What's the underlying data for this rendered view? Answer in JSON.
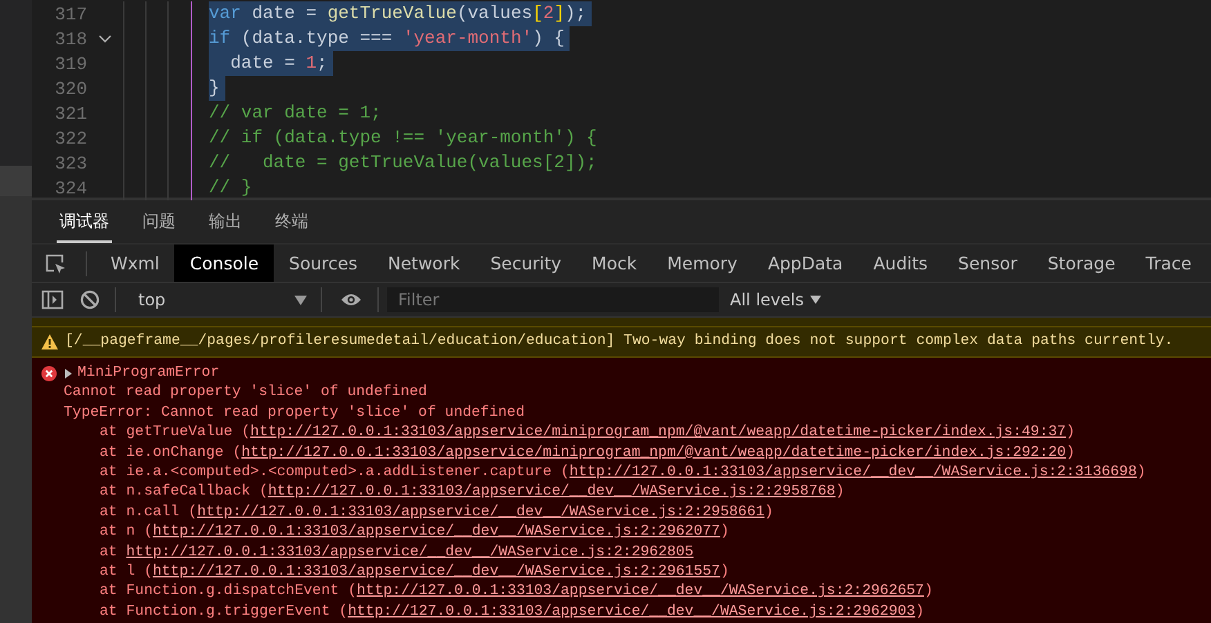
{
  "editor": {
    "lines": [
      {
        "number": "317",
        "foldable": false,
        "selected": true,
        "tokens": [
          {
            "kind": "keyword",
            "text": "var"
          },
          {
            "kind": "plain",
            "text": " date = "
          },
          {
            "kind": "func",
            "text": "getTrueValue"
          },
          {
            "kind": "plain",
            "text": "(values"
          },
          {
            "kind": "bracket",
            "text": "["
          },
          {
            "kind": "number",
            "text": "2"
          },
          {
            "kind": "bracket",
            "text": "]"
          },
          {
            "kind": "plain",
            "text": ");"
          }
        ]
      },
      {
        "number": "318",
        "foldable": true,
        "selected": true,
        "tokens": [
          {
            "kind": "keyword",
            "text": "if"
          },
          {
            "kind": "plain",
            "text": " (data.type === "
          },
          {
            "kind": "string",
            "text": "'year-month'"
          },
          {
            "kind": "plain",
            "text": ") {"
          }
        ]
      },
      {
        "number": "319",
        "foldable": false,
        "selected": true,
        "tokens": [
          {
            "kind": "plain",
            "text": "  date = "
          },
          {
            "kind": "number",
            "text": "1"
          },
          {
            "kind": "plain",
            "text": ";"
          }
        ]
      },
      {
        "number": "320",
        "foldable": false,
        "selected": true,
        "tokens": [
          {
            "kind": "plain",
            "text": "}"
          }
        ]
      },
      {
        "number": "321",
        "foldable": false,
        "selected": false,
        "tokens": [
          {
            "kind": "comment",
            "text": "// var date = 1;"
          }
        ]
      },
      {
        "number": "322",
        "foldable": false,
        "selected": false,
        "tokens": [
          {
            "kind": "comment",
            "text": "// if (data.type !== 'year-month') {"
          }
        ]
      },
      {
        "number": "323",
        "foldable": false,
        "selected": false,
        "tokens": [
          {
            "kind": "comment",
            "text": "//   date = getTrueValue(values[2]);"
          }
        ]
      },
      {
        "number": "324",
        "foldable": false,
        "selected": false,
        "tokens": [
          {
            "kind": "comment",
            "text": "// }"
          }
        ]
      }
    ]
  },
  "panel_tabs": [
    {
      "label": "调试器",
      "selected": true
    },
    {
      "label": "问题",
      "selected": false
    },
    {
      "label": "输出",
      "selected": false
    },
    {
      "label": "终端",
      "selected": false
    }
  ],
  "devtools_tabs": [
    {
      "label": "Wxml",
      "selected": false
    },
    {
      "label": "Console",
      "selected": true
    },
    {
      "label": "Sources",
      "selected": false
    },
    {
      "label": "Network",
      "selected": false
    },
    {
      "label": "Security",
      "selected": false
    },
    {
      "label": "Mock",
      "selected": false
    },
    {
      "label": "Memory",
      "selected": false
    },
    {
      "label": "AppData",
      "selected": false
    },
    {
      "label": "Audits",
      "selected": false
    },
    {
      "label": "Sensor",
      "selected": false
    },
    {
      "label": "Storage",
      "selected": false
    },
    {
      "label": "Trace",
      "selected": false
    }
  ],
  "console_toolbar": {
    "context": "top",
    "filter": {
      "placeholder": "Filter"
    },
    "levels": "All levels"
  },
  "messages": [
    {
      "kind": "warning",
      "text": "[/__pageframe__/pages/profileresumedetail/education/education] Two-way binding does not support complex data paths currently."
    },
    {
      "kind": "error",
      "title": "MiniProgramError",
      "expanded": false,
      "lines": [
        "Cannot read property 'slice' of undefined",
        "TypeError: Cannot read property 'slice' of undefined"
      ],
      "stack": [
        {
          "prefix": "at getTrueValue (",
          "url": "http://127.0.0.1:33103/appservice/miniprogram_npm/@vant/weapp/datetime-picker/index.js:49:37",
          "suffix": ")"
        },
        {
          "prefix": "at ie.onChange (",
          "url": "http://127.0.0.1:33103/appservice/miniprogram_npm/@vant/weapp/datetime-picker/index.js:292:20",
          "suffix": ")"
        },
        {
          "prefix": "at ie.a.<computed>.<computed>.a.addListener.capture (",
          "url": "http://127.0.0.1:33103/appservice/__dev__/WAService.js:2:3136698",
          "suffix": ")"
        },
        {
          "prefix": "at n.safeCallback (",
          "url": "http://127.0.0.1:33103/appservice/__dev__/WAService.js:2:2958768",
          "suffix": ")"
        },
        {
          "prefix": "at n.call (",
          "url": "http://127.0.0.1:33103/appservice/__dev__/WAService.js:2:2958661",
          "suffix": ")"
        },
        {
          "prefix": "at n (",
          "url": "http://127.0.0.1:33103/appservice/__dev__/WAService.js:2:2962077",
          "suffix": ")"
        },
        {
          "prefix": "at ",
          "url": "http://127.0.0.1:33103/appservice/__dev__/WAService.js:2:2962805"
        },
        {
          "prefix": "at l (",
          "url": "http://127.0.0.1:33103/appservice/__dev__/WAService.js:2:2961557",
          "suffix": ")"
        },
        {
          "prefix": "at Function.g.dispatchEvent (",
          "url": "http://127.0.0.1:33103/appservice/__dev__/WAService.js:2:2962657",
          "suffix": ")"
        },
        {
          "prefix": "at Function.g.triggerEvent (",
          "url": "http://127.0.0.1:33103/appservice/__dev__/WAService.js:2:2962903",
          "suffix": ")"
        }
      ]
    }
  ]
}
